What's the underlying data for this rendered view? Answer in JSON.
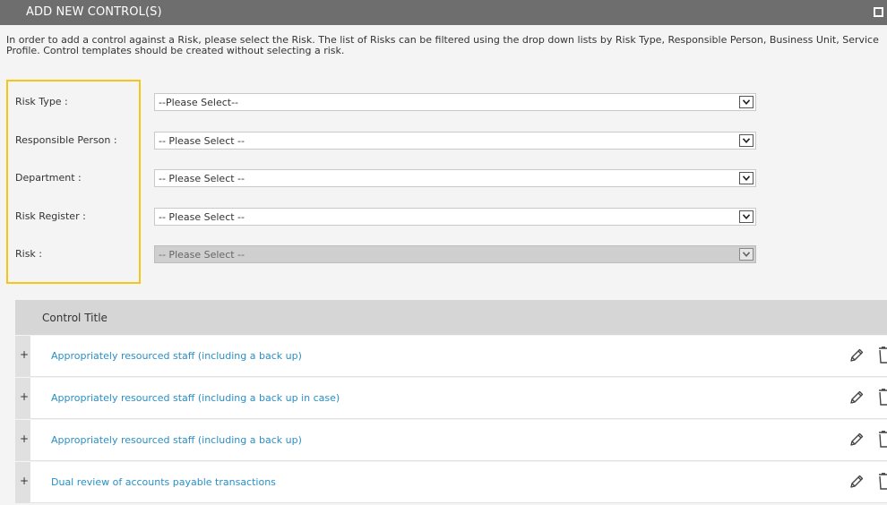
{
  "header": {
    "title": "ADD NEW CONTROL(S)"
  },
  "intro": "In order to add a control against a Risk, please select the Risk. The list of Risks can be filtered using the drop down lists by Risk Type, Responsible Person, Business Unit, Service Profile. Control templates should be created without selecting a risk.",
  "filters": [
    {
      "label": "Risk Type :",
      "value": "--Please Select--",
      "disabled": false
    },
    {
      "label": "Responsible Person :",
      "value": "-- Please Select --",
      "disabled": false
    },
    {
      "label": "Department :",
      "value": "-- Please Select --",
      "disabled": false
    },
    {
      "label": "Risk Register :",
      "value": "-- Please Select --",
      "disabled": false
    },
    {
      "label": "Risk :",
      "value": "-- Please Select --",
      "disabled": true
    }
  ],
  "grid": {
    "header": "Control Title",
    "rows": [
      {
        "expand": "+",
        "title": "Appropriately resourced staff (including a back up)"
      },
      {
        "expand": "+",
        "title": "Appropriately resourced staff (including a back up in case)"
      },
      {
        "expand": "+",
        "title": "Appropriately resourced staff (including a back up)"
      },
      {
        "expand": "+",
        "title": "Dual review of accounts payable transactions"
      }
    ]
  },
  "icons": {
    "maximize": "maximize-icon",
    "dropdown": "chevron-down-icon",
    "edit": "pencil-icon",
    "delete": "trash-icon"
  },
  "colors": {
    "titlebar": "#6e6e6e",
    "highlight": "#f5c518",
    "link": "#2a8fc6"
  }
}
